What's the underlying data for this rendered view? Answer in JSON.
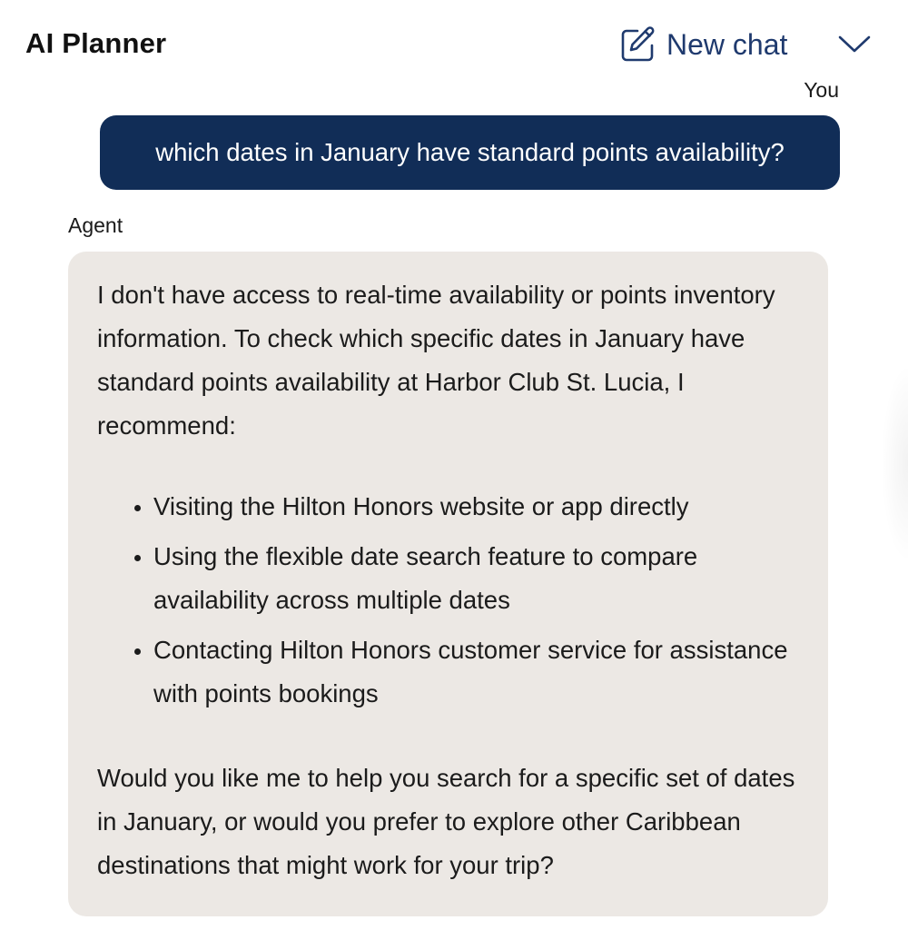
{
  "header": {
    "title": "AI Planner",
    "new_chat_label": "New chat",
    "new_chat_icon": "edit-square-icon",
    "menu_icon": "chevron-down-icon",
    "accent_color": "#1f3a6e"
  },
  "conversation": {
    "user_label": "You",
    "user_message": "which dates in January have standard points availability?",
    "user_bubble_color": "#112d57",
    "agent_label": "Agent",
    "agent_bubble_color": "#ece8e4",
    "agent_intro": "I don't have access to real-time availability or points inventory information. To check which specific dates in January have standard points availability at Harbor Club St. Lucia, I recommend:",
    "agent_recommendations": [
      "Visiting the Hilton Honors website or app directly",
      "Using the flexible date search feature to compare availability across multiple dates",
      "Contacting Hilton Honors customer service for assistance with points bookings"
    ],
    "agent_followup": "Would you like me to help you search for a specific set of dates in January, or would you prefer to explore other Caribbean destinations that might work for your trip?"
  }
}
